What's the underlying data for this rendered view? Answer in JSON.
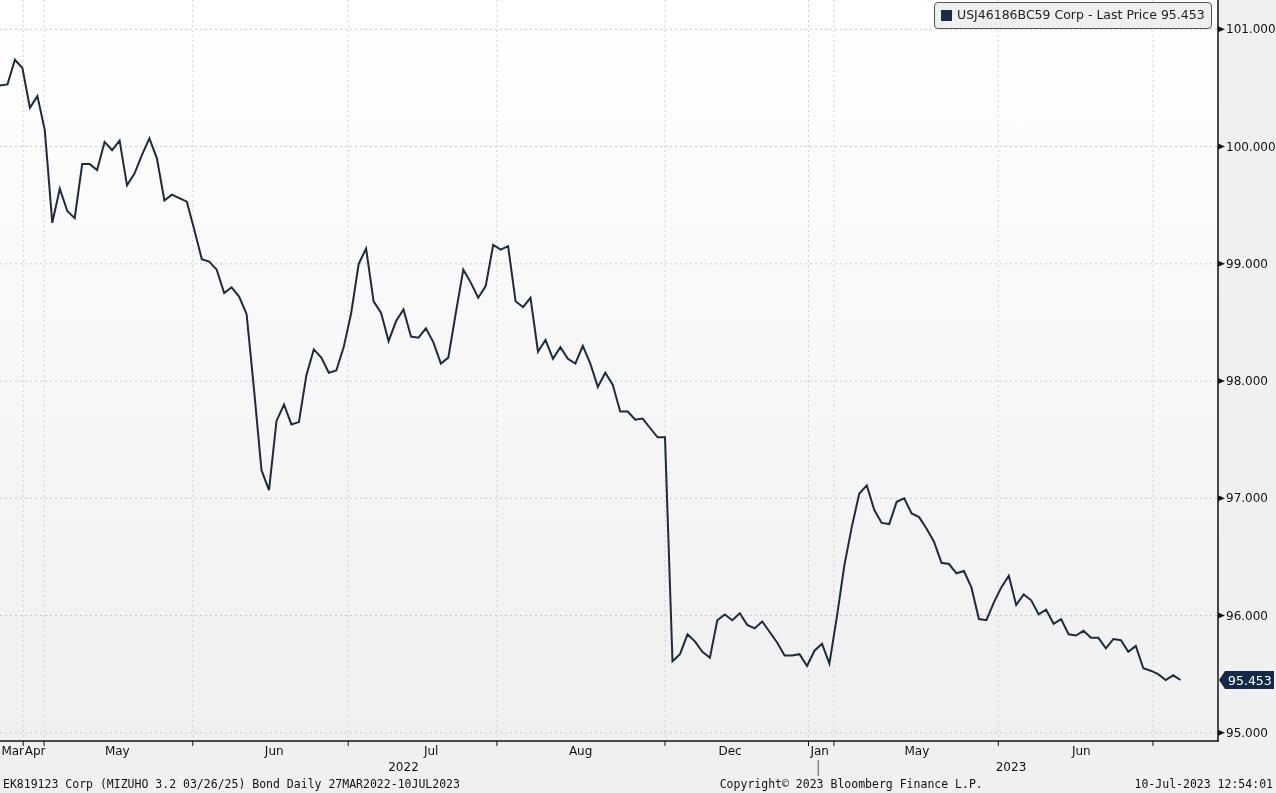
{
  "chart": {
    "legend": {
      "value": "95.453"
    },
    "last_tag": "95.453",
    "chart_data": {
      "type": "line",
      "categories": [
        null,
        null,
        "Mar",
        null,
        null,
        "Apr",
        null,
        null,
        null,
        null,
        null,
        null,
        null,
        null,
        null,
        null,
        "May",
        null,
        null,
        null,
        null,
        null,
        null,
        null,
        null,
        null,
        null,
        null,
        null,
        null,
        null,
        null,
        null,
        null,
        null,
        null,
        null,
        "Jun",
        null,
        null,
        null,
        null,
        null,
        null,
        null,
        null,
        null,
        null,
        null,
        null,
        null,
        null,
        null,
        null,
        null,
        null,
        null,
        null,
        "Jul",
        null,
        null,
        null,
        null,
        null,
        null,
        null,
        null,
        null,
        null,
        null,
        null,
        null,
        null,
        null,
        null,
        null,
        null,
        null,
        "Aug",
        null,
        null,
        null,
        null,
        null,
        null,
        null,
        null,
        null,
        null,
        null,
        null,
        null,
        null,
        null,
        null,
        null,
        null,
        null,
        "Dec",
        null,
        null,
        null,
        null,
        null,
        null,
        null,
        null,
        null,
        null,
        null,
        "Jan",
        null,
        null,
        null,
        null,
        null,
        null,
        null,
        null,
        null,
        null,
        null,
        null,
        "May",
        null,
        null,
        null,
        null,
        null,
        null,
        null,
        null,
        null,
        null,
        null,
        null,
        null,
        null,
        null,
        null,
        null,
        null,
        null,
        null,
        null,
        "Jun",
        null,
        null,
        null,
        null,
        null,
        null,
        null,
        null,
        null,
        null,
        null,
        null,
        null
      ],
      "series": [
        {
          "name": "USJ46186BC59 Corp - Last Price",
          "color": "#1c2b3e",
          "values": [
            100.52,
            100.53,
            100.74,
            100.67,
            100.33,
            100.43,
            100.14,
            99.35,
            99.64,
            99.45,
            99.39,
            99.85,
            99.85,
            99.8,
            100.04,
            99.97,
            100.05,
            99.67,
            99.77,
            99.93,
            100.07,
            99.9,
            99.54,
            99.59,
            99.56,
            99.53,
            99.29,
            99.04,
            99.02,
            98.95,
            98.75,
            98.8,
            98.72,
            98.57,
            97.92,
            97.24,
            97.07,
            97.66,
            97.8,
            97.63,
            97.65,
            98.05,
            98.27,
            98.2,
            98.07,
            98.09,
            98.29,
            98.58,
            99.0,
            99.13,
            98.68,
            98.58,
            98.34,
            98.51,
            98.61,
            98.38,
            98.37,
            98.45,
            98.33,
            98.15,
            98.2,
            98.58,
            98.95,
            98.84,
            98.71,
            98.81,
            99.16,
            99.12,
            99.15,
            98.68,
            98.63,
            98.71,
            98.25,
            98.35,
            98.19,
            98.29,
            98.19,
            98.15,
            98.3,
            98.15,
            97.95,
            98.07,
            97.97,
            97.74,
            97.74,
            97.67,
            97.68,
            97.6,
            97.52,
            97.52,
            95.61,
            95.67,
            95.84,
            95.78,
            95.69,
            95.64,
            95.96,
            96.01,
            95.96,
            96.02,
            95.92,
            95.89,
            95.95,
            95.86,
            95.77,
            95.66,
            95.66,
            95.67,
            95.57,
            95.7,
            95.76,
            95.59,
            95.99,
            96.43,
            96.76,
            97.04,
            97.11,
            96.9,
            96.79,
            96.78,
            96.97,
            97.0,
            96.87,
            96.84,
            96.74,
            96.63,
            96.45,
            96.44,
            96.36,
            96.38,
            96.24,
            95.97,
            95.96,
            96.11,
            96.24,
            96.34,
            96.09,
            96.18,
            96.13,
            96.01,
            96.05,
            95.93,
            95.97,
            95.84,
            95.83,
            95.87,
            95.81,
            95.81,
            95.72,
            95.8,
            95.79,
            95.69,
            95.74,
            95.55,
            95.53,
            95.5,
            95.45,
            95.49,
            95.45
          ]
        }
      ],
      "grid": true,
      "ylim": [
        94.93,
        101.25
      ],
      "yticks": [
        {
          "value": 95,
          "label": "95.000"
        },
        {
          "value": 96,
          "label": "96.000"
        },
        {
          "value": 97,
          "label": "97.000"
        },
        {
          "value": 98,
          "label": "98.000"
        },
        {
          "value": 99,
          "label": "99.000"
        },
        {
          "value": 100,
          "label": "100.000"
        },
        {
          "value": 101,
          "label": "101.000"
        }
      ],
      "annotations": [
        "2022",
        "2023"
      ]
    }
  },
  "footer": {
    "security": "EK819123 Corp (MIZUHO 3.2 03/26/25) Bond  Daily 27MAR2022-10JUL2023",
    "copyright": "Copyright© 2023 Bloomberg Finance L.P.",
    "timestamp": "10-Jul-2023 12:54:01"
  }
}
